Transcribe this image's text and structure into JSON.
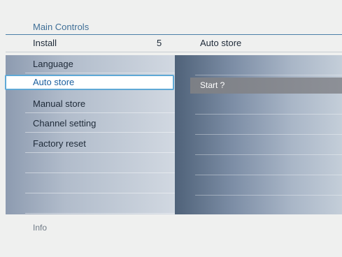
{
  "breadcrumb": "Main Controls",
  "header": {
    "left_title": "Install",
    "number": "5",
    "right_title": "Auto store"
  },
  "menu": {
    "items": [
      {
        "label": "Language"
      },
      {
        "label": "Auto store",
        "selected": true
      },
      {
        "label": "Manual store"
      },
      {
        "label": "Channel setting"
      },
      {
        "label": "Factory reset"
      },
      {
        "label": ""
      },
      {
        "label": ""
      },
      {
        "label": ""
      }
    ]
  },
  "submenu": {
    "items": [
      {
        "label": "Start ?"
      }
    ]
  },
  "footer": {
    "info_label": "Info"
  },
  "colors": {
    "accent": "#5fa9d6",
    "rule": "#4a7fa8",
    "selected_text": "#1b5f9e"
  }
}
